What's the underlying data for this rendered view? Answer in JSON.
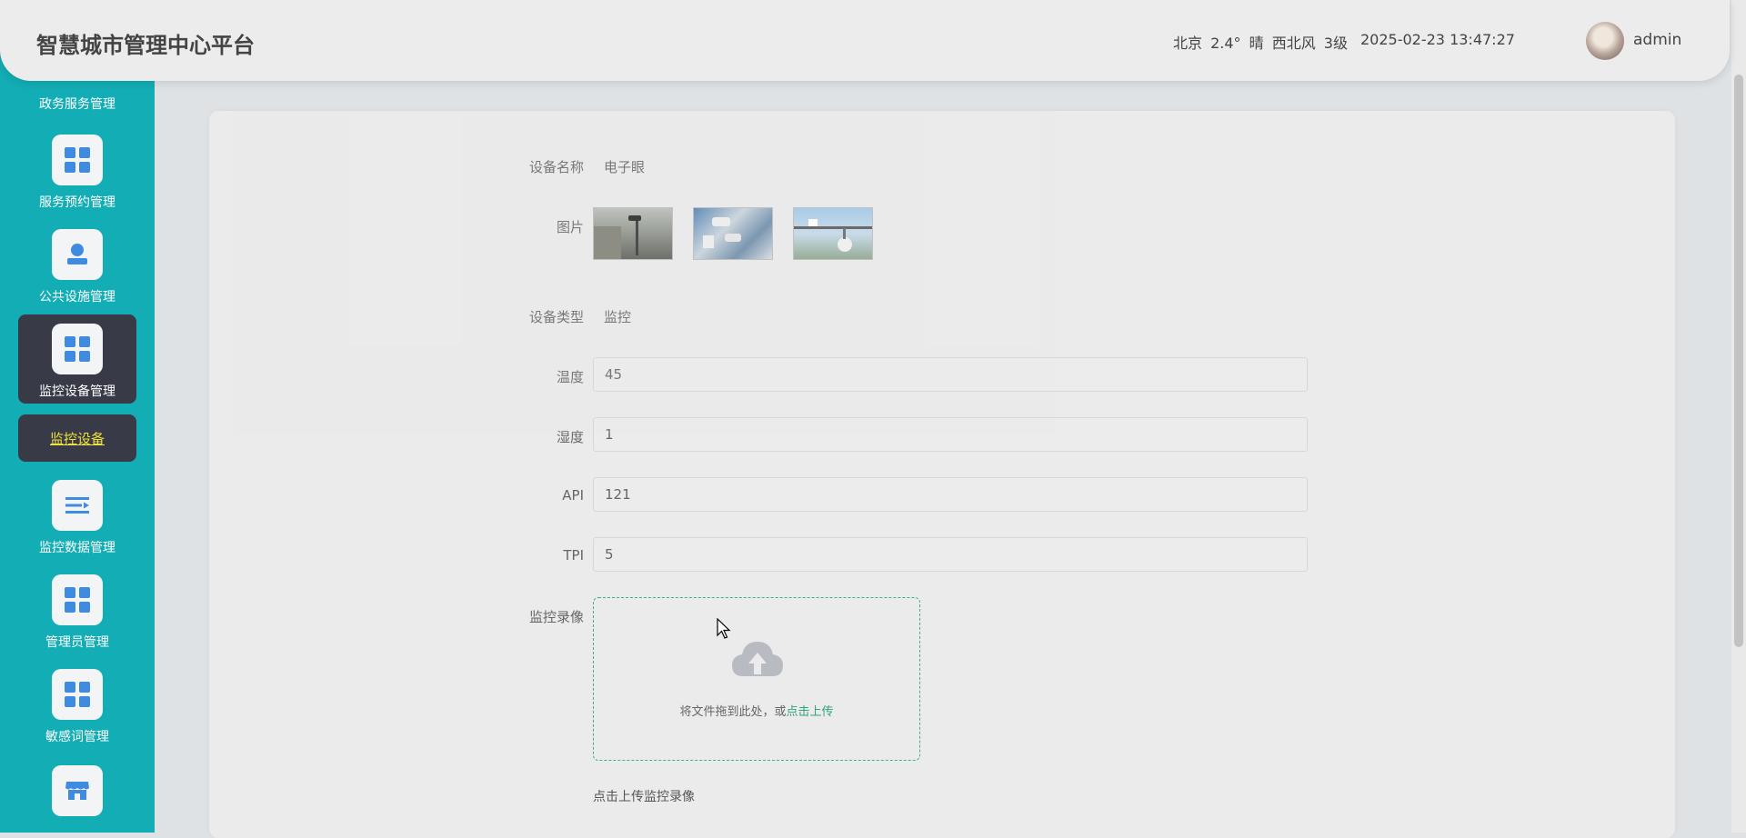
{
  "header": {
    "title": "智慧城市管理中心平台",
    "weather": "北京 2.4° 晴 西北风 3级",
    "datetime": "2025-02-23 13:47:27",
    "username": "admin"
  },
  "sidebar": {
    "partial_label": "政务服务管理",
    "items": [
      {
        "label": "服务预约管理",
        "icon": "grid-icon"
      },
      {
        "label": "公共设施管理",
        "icon": "person-icon"
      },
      {
        "label": "监控设备管理",
        "icon": "grid-icon",
        "active": true
      },
      {
        "label": "监控数据管理",
        "icon": "list-icon"
      },
      {
        "label": "管理员管理",
        "icon": "grid-icon"
      },
      {
        "label": "敏感词管理",
        "icon": "grid-icon"
      },
      {
        "label": "",
        "icon": "store-icon"
      }
    ],
    "submenu": {
      "label": "监控设备"
    }
  },
  "form": {
    "device_name": {
      "label": "设备名称",
      "value": "电子眼"
    },
    "images": {
      "label": "图片",
      "count": 3
    },
    "device_type": {
      "label": "设备类型",
      "value": "监控"
    },
    "temperature": {
      "label": "温度",
      "value": "45"
    },
    "humidity": {
      "label": "湿度",
      "value": "1"
    },
    "api": {
      "label": "API",
      "value": "121"
    },
    "tpi": {
      "label": "TPI",
      "value": "5"
    },
    "video": {
      "label": "监控录像",
      "drop_text": "将文件拖到此处，或",
      "click_text": "点击上传",
      "hint": "点击上传监控录像"
    }
  },
  "colors": {
    "sidebar": "#12adb5",
    "active_item": "#383b47",
    "submenu_text": "#f0e23a",
    "accent_link": "#2fa37a",
    "icon_blue": "#3f8be0"
  }
}
